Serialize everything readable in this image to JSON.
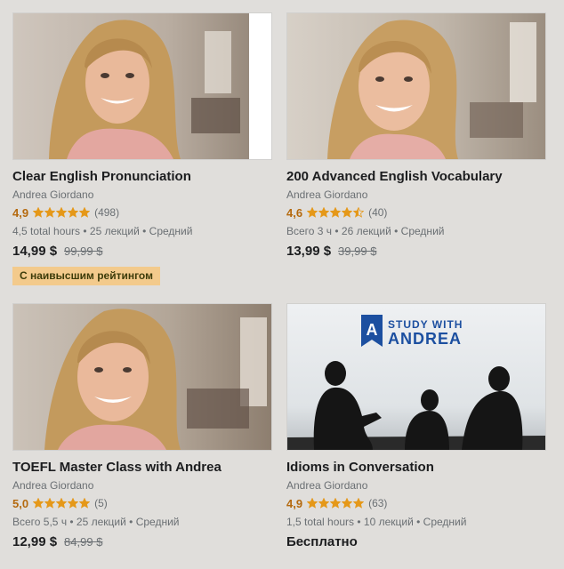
{
  "colors": {
    "rating": "#b4690e",
    "star": "#e59819",
    "badge_bg": "#f3ca8c"
  },
  "courses": [
    {
      "title": "Clear English Pronunciation",
      "author": "Andrea Giordano",
      "rating": "4,9",
      "stars": 5,
      "reviews": "(498)",
      "meta": "4,5 total hours • 25 лекций • Средний",
      "price": "14,99 $",
      "old_price": "99,99 $",
      "badge": "С наивысшим рейтингом"
    },
    {
      "title": "200 Advanced English Vocabulary",
      "author": "Andrea Giordano",
      "rating": "4,6",
      "stars": 4.5,
      "reviews": "(40)",
      "meta": "Всего 3 ч • 26 лекций • Средний",
      "price": "13,99 $",
      "old_price": "39,99 $"
    },
    {
      "title": "TOEFL Master Class with Andrea",
      "author": "Andrea Giordano",
      "rating": "5,0",
      "stars": 5,
      "reviews": "(5)",
      "meta": "Всего 5,5 ч • 25 лекций • Средний",
      "price": "12,99 $",
      "old_price": "84,99 $"
    },
    {
      "title": "Idioms in Conversation",
      "author": "Andrea Giordano",
      "rating": "4,9",
      "stars": 5,
      "reviews": "(63)",
      "meta": "1,5 total hours • 10 лекций • Средний",
      "price": "Бесплатно",
      "thumb_logo_line1": "STUDY WITH",
      "thumb_logo_line2": "ANDREA",
      "thumb_logo_letter": "A"
    }
  ]
}
